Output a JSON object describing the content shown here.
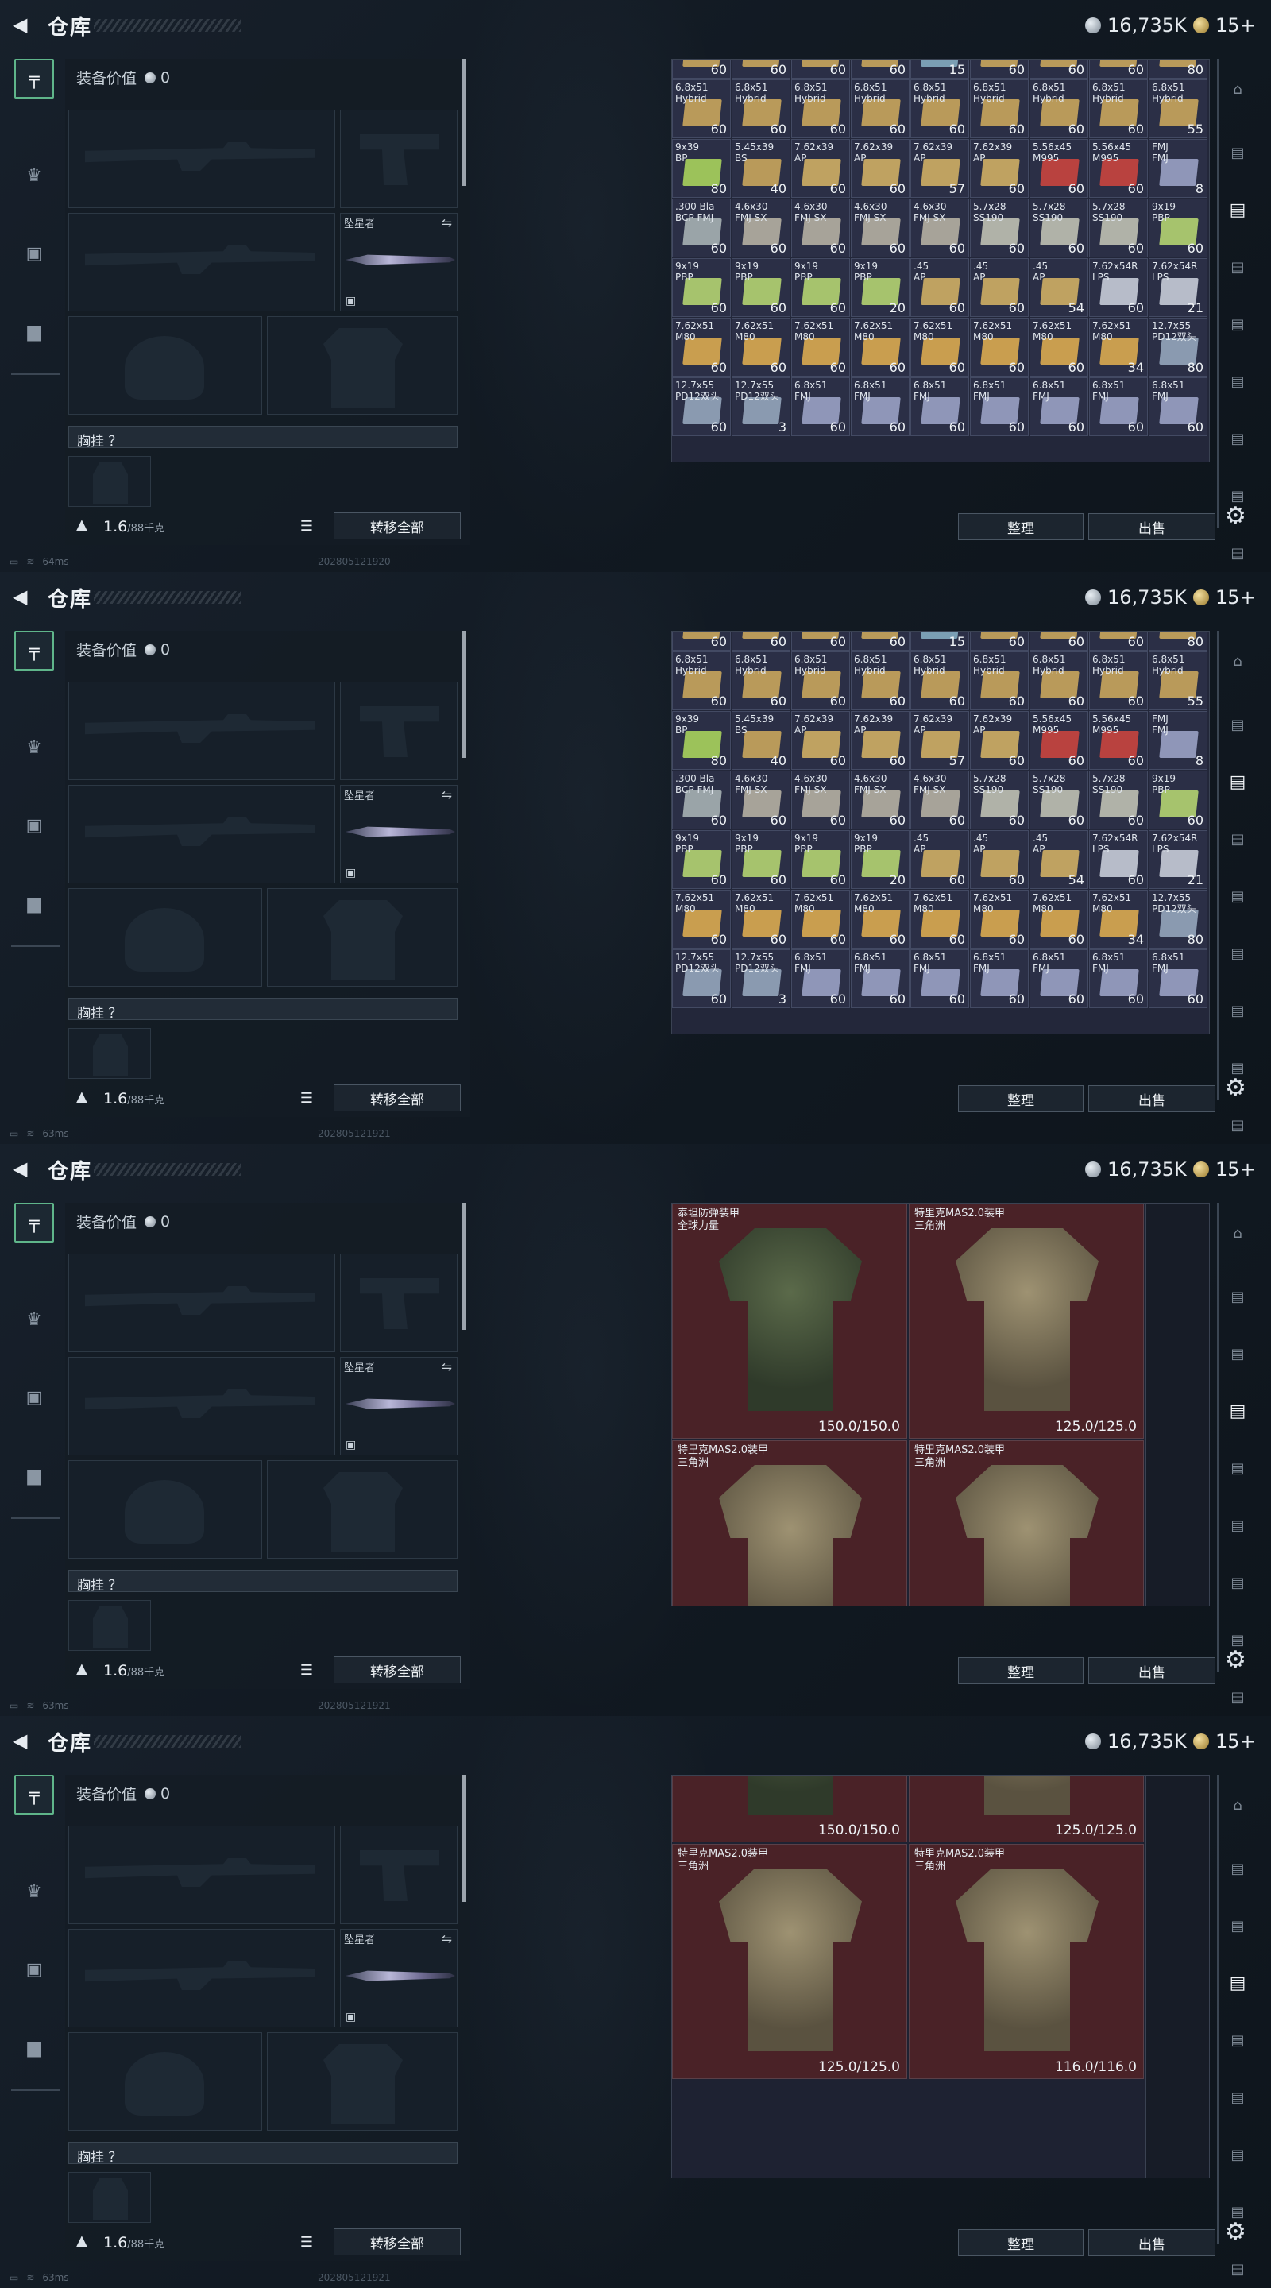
{
  "header": {
    "title": "仓库",
    "silver": "16,735K",
    "gold": "15+"
  },
  "equipment": {
    "value_label": "装备价值",
    "value": "0",
    "melee_label": "坠星者",
    "chest_label": "胸挂 ？",
    "weight": "1.6",
    "weight_max": "/88千克",
    "transfer_all": "转移全部"
  },
  "actions": {
    "sort": "整理",
    "sell": "出售"
  },
  "screens": [
    {
      "ping": "64ms",
      "uid": "202805121920"
    },
    {
      "ping": "63ms",
      "uid": "202805121921"
    },
    {
      "ping": "63ms",
      "uid": "202805121921"
    },
    {
      "ping": "63ms",
      "uid": "202805121921"
    }
  ],
  "ammo_grid": {
    "partial_top_counts": [
      "60",
      "60",
      "60",
      "60",
      "15",
      "60",
      "60",
      "60",
      "80"
    ],
    "rows": [
      [
        [
          "6.8x51\nHybrid",
          "60"
        ],
        [
          "6.8x51\nHybrid",
          "60"
        ],
        [
          "6.8x51\nHybrid",
          "60"
        ],
        [
          "6.8x51\nHybrid",
          "60"
        ],
        [
          "6.8x51\nHybrid",
          "60"
        ],
        [
          "6.8x51\nHybrid",
          "60"
        ],
        [
          "6.8x51\nHybrid",
          "60"
        ],
        [
          "6.8x51\nHybrid",
          "60"
        ],
        [
          "6.8x51\nHybrid",
          "55"
        ]
      ],
      [
        [
          "9x39\nBP",
          "80"
        ],
        [
          "5.45x39\nBS",
          "40"
        ],
        [
          "7.62x39\nAP",
          "60"
        ],
        [
          "7.62x39\nAP",
          "60"
        ],
        [
          "7.62x39\nAP",
          "57"
        ],
        [
          "7.62x39\nAP",
          "60"
        ],
        [
          "5.56x45\nM995",
          "60"
        ],
        [
          "5.56x45\nM995",
          "60"
        ],
        [
          "FMJ\nFMJ",
          "8"
        ]
      ],
      [
        [
          ".300 Bla\nBCP FMJ",
          "60"
        ],
        [
          "4.6x30\nFMJ SX",
          "60"
        ],
        [
          "4.6x30\nFMJ SX",
          "60"
        ],
        [
          "4.6x30\nFMJ SX",
          "60"
        ],
        [
          "4.6x30\nFMJ SX",
          "60"
        ],
        [
          "5.7x28\nSS190",
          "60"
        ],
        [
          "5.7x28\nSS190",
          "60"
        ],
        [
          "5.7x28\nSS190",
          "60"
        ],
        [
          "9x19\nPBP",
          "60"
        ]
      ],
      [
        [
          "9x19\nPBP",
          "60"
        ],
        [
          "9x19\nPBP",
          "60"
        ],
        [
          "9x19\nPBP",
          "60"
        ],
        [
          "9x19\nPBP",
          "20"
        ],
        [
          ".45\nAP",
          "60"
        ],
        [
          ".45\nAP",
          "60"
        ],
        [
          ".45\nAP",
          "54"
        ],
        [
          "7.62x54R\nLPS",
          "60"
        ],
        [
          "7.62x54R\nLPS",
          "21"
        ]
      ],
      [
        [
          "7.62x51\nM80",
          "60"
        ],
        [
          "7.62x51\nM80",
          "60"
        ],
        [
          "7.62x51\nM80",
          "60"
        ],
        [
          "7.62x51\nM80",
          "60"
        ],
        [
          "7.62x51\nM80",
          "60"
        ],
        [
          "7.62x51\nM80",
          "60"
        ],
        [
          "7.62x51\nM80",
          "60"
        ],
        [
          "7.62x51\nM80",
          "34"
        ],
        [
          "12.7x55\nPD12双头",
          "80"
        ]
      ],
      [
        [
          "12.7x55\nPD12双头",
          "60"
        ],
        [
          "12.7x55\nPD12双头",
          "3"
        ],
        [
          "6.8x51\nFMJ",
          "60"
        ],
        [
          "6.8x51\nFMJ",
          "60"
        ],
        [
          "6.8x51\nFMJ",
          "60"
        ],
        [
          "6.8x51\nFMJ",
          "60"
        ],
        [
          "6.8x51\nFMJ",
          "60"
        ],
        [
          "6.8x51\nFMJ",
          "60"
        ],
        [
          "6.8x51\nFMJ",
          "60"
        ]
      ]
    ]
  },
  "armor_items": [
    {
      "name": "泰坦防弹装甲\n全球力量",
      "durability": "150.0/150.0"
    },
    {
      "name": "特里克MAS2.0装甲\n三角洲",
      "durability": "125.0/125.0"
    },
    {
      "name": "特里克MAS2.0装甲\n三角洲",
      "durability": "125.0/125.0"
    },
    {
      "name": "特里克MAS2.0装甲\n三角洲",
      "durability": "125.0/125.0"
    },
    {
      "name": "特里克MAS2.0装甲\n三角洲",
      "durability": "125.0/125.0"
    },
    {
      "name": "特里克MAS2.0装甲\n三角洲",
      "durability": "116.0/116.0"
    }
  ],
  "colors": {
    "accent": "#5fb58a",
    "armor_bg": "#4a2227",
    "stash_bg": "#262a3e"
  }
}
